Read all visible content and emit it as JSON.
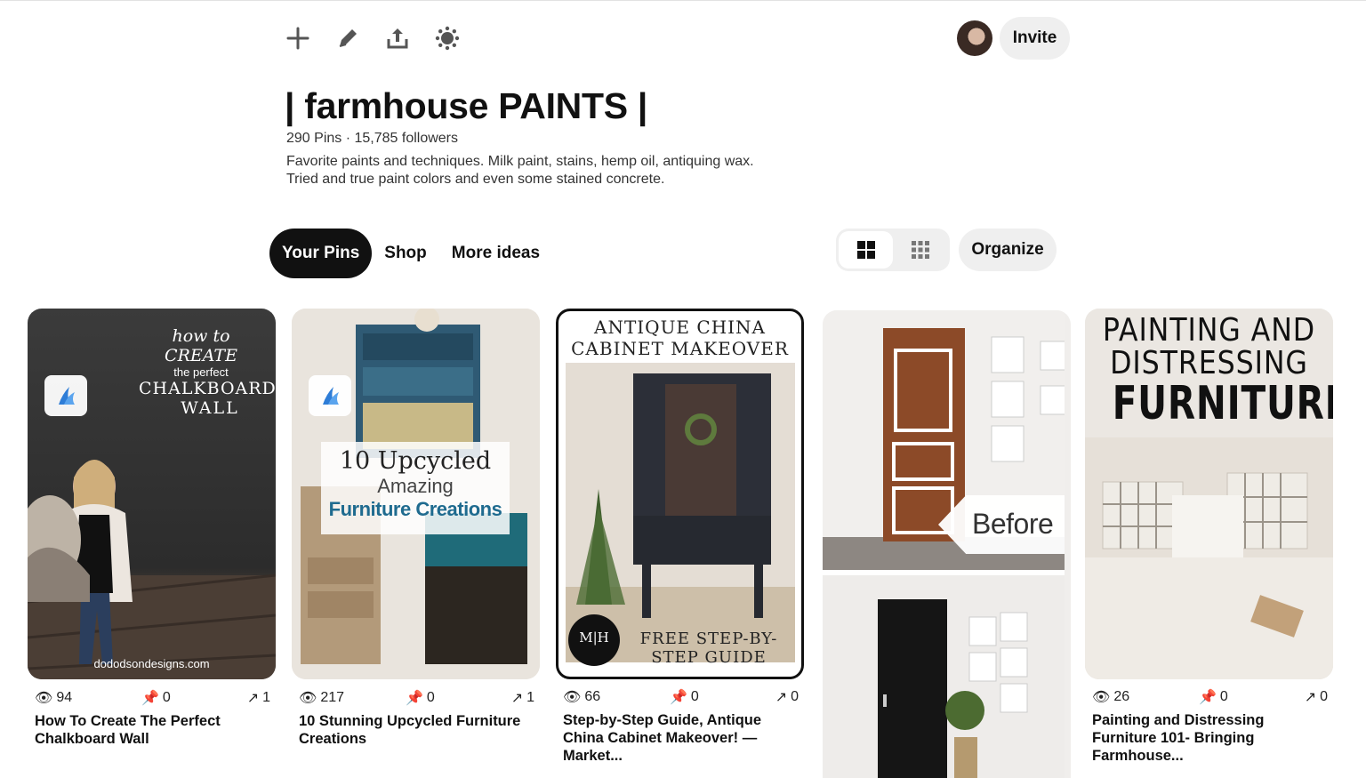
{
  "toolbar": {
    "icons": [
      "plus-icon",
      "pencil-icon",
      "share-icon",
      "sparkle-icon"
    ]
  },
  "header": {
    "invite_label": "Invite"
  },
  "board": {
    "title": "| farmhouse PAINTS |",
    "meta": "290 Pins · 15,785 followers",
    "description_line1": "Favorite paints and techniques. Milk paint, stains, hemp oil, antiquing wax.",
    "description_line2": "Tried and true paint colors and even some stained concrete."
  },
  "tabs": {
    "your_pins": "Your Pins",
    "shop": "Shop",
    "more_ideas": "More ideas"
  },
  "view": {
    "organize_label": "Organize"
  },
  "pins": [
    {
      "overlay_script1": "how to CREATE",
      "overlay_script2": "the perfect",
      "overlay_script3": "CHALKBOARD",
      "overlay_script4": "WALL",
      "watermark": "dododsondesigns.com",
      "views": "94",
      "saves": "0",
      "clicks": "1",
      "title_line1": "How To Create The Perfect",
      "title_line2": "Chalkboard Wall"
    },
    {
      "overlay_line1": "10 Upcycled",
      "overlay_line2": "Amazing",
      "overlay_line3": "Furniture Creations",
      "views": "217",
      "saves": "0",
      "clicks": "1",
      "title_line1": "10 Stunning Upcycled Furniture",
      "title_line2": "Creations"
    },
    {
      "overlay_top1": "Antique China",
      "overlay_top2": "Cabinet Makeover",
      "overlay_bottom1": "Free Step-by-",
      "overlay_bottom2": "Step Guide",
      "logo": "M|H",
      "views": "66",
      "saves": "0",
      "clicks": "0",
      "title_line1": "Step-by-Step Guide, Antique",
      "title_line2": "China Cabinet Makeover! —",
      "title_line3": "Market..."
    },
    {
      "overlay_label": "Before"
    },
    {
      "overlay_line1": "PAINTING AND",
      "overlay_line2": "DISTRESSING",
      "overlay_line3": "FURNITURE",
      "views": "26",
      "saves": "0",
      "clicks": "0",
      "title_line1": "Painting and Distressing",
      "title_line2": "Furniture 101- Bringing",
      "title_line3": "Farmhouse..."
    }
  ],
  "colors": {
    "active_tab_bg": "#111111",
    "pill_bg": "#efefef",
    "save_badge_blue": "#2e7dd7"
  }
}
